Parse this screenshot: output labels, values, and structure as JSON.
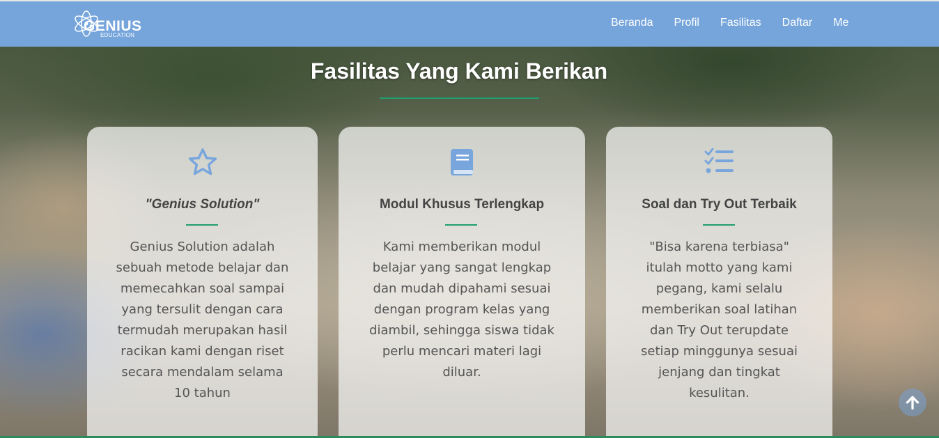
{
  "brand": {
    "name": "GENIUS",
    "sub": "EDUCATION"
  },
  "nav": {
    "items": [
      "Beranda",
      "Profil",
      "Fasilitas",
      "Daftar",
      "Me"
    ]
  },
  "section": {
    "title": "Fasilitas Yang Kami Berikan"
  },
  "cards": [
    {
      "icon": "star-icon",
      "title": "\"Genius Solution\"",
      "body": [
        "Genius Solution adalah",
        "sebuah metode belajar dan",
        "memecahkan soal sampai",
        "yang tersulit dengan cara",
        "termudah merupakan hasil",
        "racikan kami dengan riset",
        "secara mendalam selama",
        "10 tahun"
      ]
    },
    {
      "icon": "book-icon",
      "title": "Modul Khusus Terlengkap",
      "body": [
        "Kami memberikan modul",
        "belajar yang sangat lengkap",
        "dan mudah dipahami sesuai",
        "dengan program kelas yang",
        "diambil, sehingga siswa tidak",
        "perlu mencari materi lagi",
        "diluar."
      ]
    },
    {
      "icon": "checklist-icon",
      "title": "Soal dan Try Out Terbaik",
      "body": [
        "\"Bisa karena terbiasa\"",
        "itulah motto yang kami",
        "pegang, kami selalu",
        "memberikan soal latihan",
        "dan Try Out terupdate",
        "setiap minggunya sesuai",
        "jenjang dan tingkat",
        "kesulitan."
      ]
    }
  ],
  "colors": {
    "navbar": "#76a5dc",
    "accent": "#1f9e6e",
    "icon": "#78a6dc"
  },
  "back_to_top": {
    "icon": "arrow-up-icon"
  }
}
